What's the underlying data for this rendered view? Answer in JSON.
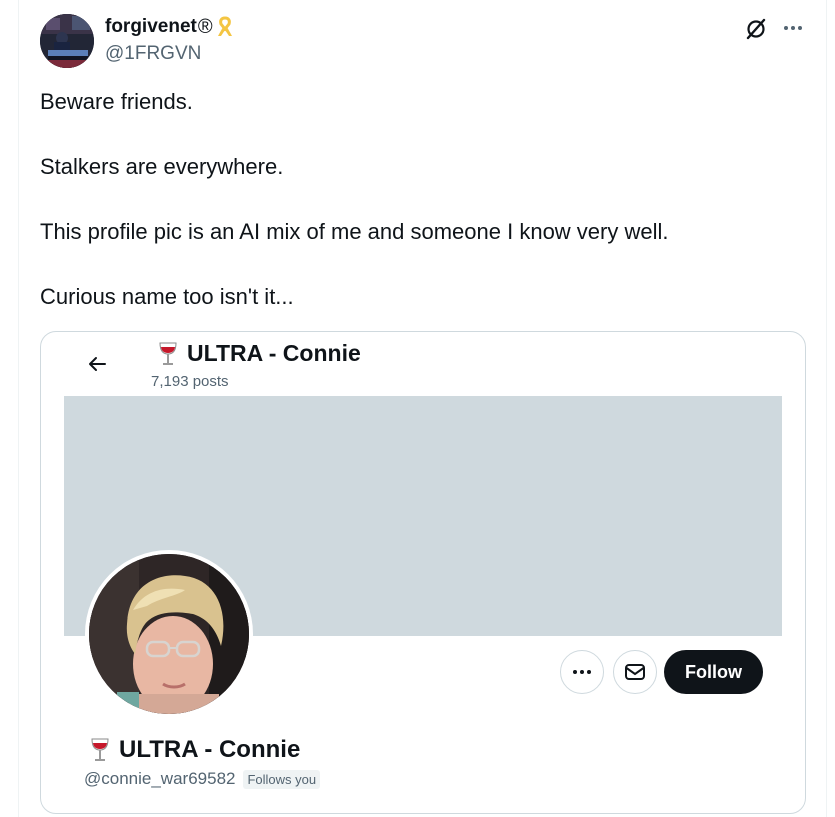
{
  "tweet": {
    "author": {
      "name": "forgivenet",
      "registered_mark": "®",
      "badge_icon": "awareness-ribbon-icon",
      "handle": "@1FRGVN"
    },
    "icons": {
      "grok": "grok-icon",
      "more": "more-options-icon"
    },
    "text_paragraphs": [
      "Beware friends.",
      "Stalkers are everywhere.",
      "This profile pic is an AI mix of me and someone I know very well.",
      "Curious name too isn't it..."
    ]
  },
  "screenshot_card": {
    "header": {
      "back_icon": "back-arrow-icon",
      "display_name": "ULTRA - Connie",
      "name_emoji_icon": "wine-glass-icon",
      "posts_count": "7,193 posts"
    },
    "actions": {
      "more_icon": "more-options-icon",
      "message_icon": "message-envelope-icon",
      "follow_label": "Follow"
    },
    "profile": {
      "display_name": "ULTRA - Connie",
      "handle": "@connie_war69582",
      "follows_you": "Follows you"
    }
  },
  "colors": {
    "text_primary": "#0f1419",
    "text_secondary": "#536471",
    "banner": "#cfd9de",
    "border": "#cfd9de",
    "follow_bg": "#0f1419",
    "ribbon": "#f4c542",
    "wine": "#c6182b"
  }
}
